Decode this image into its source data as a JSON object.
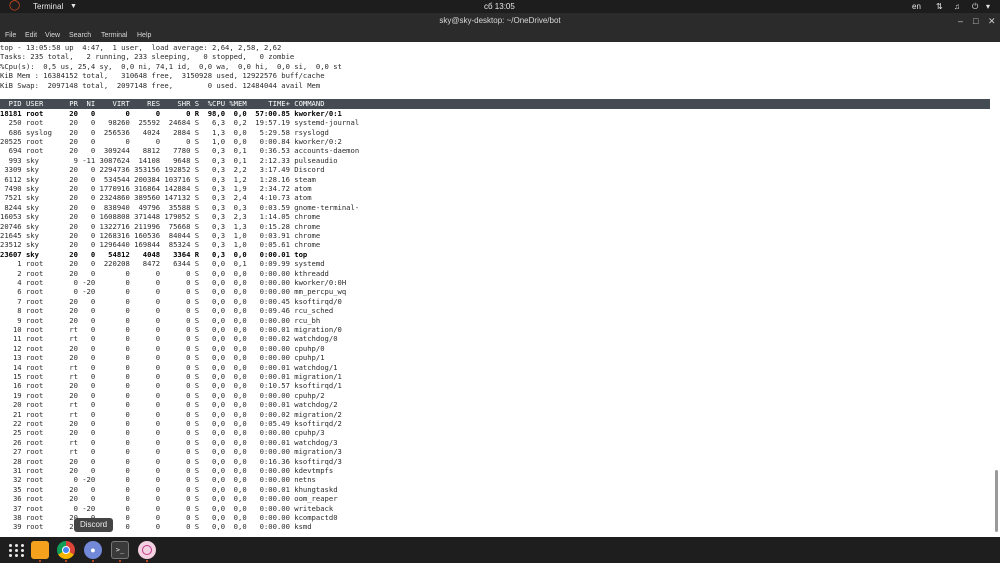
{
  "topbar": {
    "app_name": "Terminal",
    "clock": "сб 13:05",
    "language": "en"
  },
  "window": {
    "title": "sky@sky-desktop: ~/OneDrive/bot"
  },
  "menu": [
    "File",
    "Edit",
    "View",
    "Search",
    "Terminal",
    "Help"
  ],
  "top": {
    "summary": [
      "top - 13:05:58 up  4:47,  1 user,  load average: 2,64, 2,58, 2,62",
      "Tasks: 235 total,   2 running, 233 sleeping,   0 stopped,   0 zombie",
      "%Cpu(s):  0,5 us, 25,4 sy,  0,0 ni, 74,1 id,  0,0 wa,  0,0 hi,  0,0 si,  0,0 st",
      "KiB Mem : 16384152 total,   310648 free,  3150928 used, 12922576 buff/cache",
      "KiB Swap:  2097148 total,  2097148 free,        0 used. 12484044 avail Mem"
    ],
    "header": "  PID USER      PR  NI    VIRT    RES    SHR S  %CPU %MEM     TIME+ COMMAND",
    "processes": [
      {
        "text": "18181 root      20   0       0      0      0 R  98,0  0,0  57:00.85 kworker/0:1",
        "bold": true
      },
      {
        "text": "  250 root      20   0   98260  25592  24684 S   6,3  0,2  19:57.19 systemd-journal",
        "bold": false
      },
      {
        "text": "  686 syslog    20   0  256536   4024   2884 S   1,3  0,0   5:29.58 rsyslogd",
        "bold": false
      },
      {
        "text": "20525 root      20   0       0      0      0 S   1,0  0,0   0:00.84 kworker/0:2",
        "bold": false
      },
      {
        "text": "  694 root      20   0  309244   8812   7780 S   0,3  0,1   0:36.53 accounts-daemon",
        "bold": false
      },
      {
        "text": "  993 sky        9 -11 3087624  14108   9648 S   0,3  0,1   2:12.33 pulseaudio",
        "bold": false
      },
      {
        "text": " 3309 sky       20   0 2294736 353156 192852 S   0,3  2,2   3:17.49 Discord",
        "bold": false
      },
      {
        "text": " 6112 sky       20   0  534544 200384 103716 S   0,3  1,2   1:28.16 steam",
        "bold": false
      },
      {
        "text": " 7490 sky       20   0 1770916 316864 142884 S   0,3  1,9   2:34.72 atom",
        "bold": false
      },
      {
        "text": " 7521 sky       20   0 2324860 389560 147132 S   0,3  2,4   4:10.73 atom",
        "bold": false
      },
      {
        "text": " 8244 sky       20   0  838940  49796  35588 S   0,3  0,3   0:03.59 gnome-terminal-",
        "bold": false
      },
      {
        "text": "16053 sky       20   0 1608808 371448 179052 S   0,3  2,3   1:14.05 chrome",
        "bold": false
      },
      {
        "text": "20746 sky       20   0 1322716 211996  75668 S   0,3  1,3   0:15.28 chrome",
        "bold": false
      },
      {
        "text": "21645 sky       20   0 1268316 160536  84044 S   0,3  1,0   0:03.91 chrome",
        "bold": false
      },
      {
        "text": "23512 sky       20   0 1296440 169844  85324 S   0,3  1,0   0:05.61 chrome",
        "bold": false
      },
      {
        "text": "23607 sky       20   0   54812   4048   3364 R   0,3  0,0   0:00.01 top",
        "bold": true
      },
      {
        "text": "    1 root      20   0  220208   8472   6344 S   0,0  0,1   0:09.99 systemd",
        "bold": false
      },
      {
        "text": "    2 root      20   0       0      0      0 S   0,0  0,0   0:00.00 kthreadd",
        "bold": false
      },
      {
        "text": "    4 root       0 -20       0      0      0 S   0,0  0,0   0:00.00 kworker/0:0H",
        "bold": false
      },
      {
        "text": "    6 root       0 -20       0      0      0 S   0,0  0,0   0:00.00 mm_percpu_wq",
        "bold": false
      },
      {
        "text": "    7 root      20   0       0      0      0 S   0,0  0,0   0:00.45 ksoftirqd/0",
        "bold": false
      },
      {
        "text": "    8 root      20   0       0      0      0 S   0,0  0,0   0:09.46 rcu_sched",
        "bold": false
      },
      {
        "text": "    9 root      20   0       0      0      0 S   0,0  0,0   0:00.00 rcu_bh",
        "bold": false
      },
      {
        "text": "   10 root      rt   0       0      0      0 S   0,0  0,0   0:00.01 migration/0",
        "bold": false
      },
      {
        "text": "   11 root      rt   0       0      0      0 S   0,0  0,0   0:00.02 watchdog/0",
        "bold": false
      },
      {
        "text": "   12 root      20   0       0      0      0 S   0,0  0,0   0:00.00 cpuhp/0",
        "bold": false
      },
      {
        "text": "   13 root      20   0       0      0      0 S   0,0  0,0   0:00.00 cpuhp/1",
        "bold": false
      },
      {
        "text": "   14 root      rt   0       0      0      0 S   0,0  0,0   0:00.01 watchdog/1",
        "bold": false
      },
      {
        "text": "   15 root      rt   0       0      0      0 S   0,0  0,0   0:00.01 migration/1",
        "bold": false
      },
      {
        "text": "   16 root      20   0       0      0      0 S   0,0  0,0   0:10.57 ksoftirqd/1",
        "bold": false
      },
      {
        "text": "   19 root      20   0       0      0      0 S   0,0  0,0   0:00.00 cpuhp/2",
        "bold": false
      },
      {
        "text": "   20 root      rt   0       0      0      0 S   0,0  0,0   0:00.01 watchdog/2",
        "bold": false
      },
      {
        "text": "   21 root      rt   0       0      0      0 S   0,0  0,0   0:00.02 migration/2",
        "bold": false
      },
      {
        "text": "   22 root      20   0       0      0      0 S   0,0  0,0   0:05.49 ksoftirqd/2",
        "bold": false
      },
      {
        "text": "   25 root      20   0       0      0      0 S   0,0  0,0   0:00.00 cpuhp/3",
        "bold": false
      },
      {
        "text": "   26 root      rt   0       0      0      0 S   0,0  0,0   0:00.01 watchdog/3",
        "bold": false
      },
      {
        "text": "   27 root      rt   0       0      0      0 S   0,0  0,0   0:00.00 migration/3",
        "bold": false
      },
      {
        "text": "   28 root      20   0       0      0      0 S   0,0  0,0   0:16.36 ksoftirqd/3",
        "bold": false
      },
      {
        "text": "   31 root      20   0       0      0      0 S   0,0  0,0   0:00.00 kdevtmpfs",
        "bold": false
      },
      {
        "text": "   32 root       0 -20       0      0      0 S   0,0  0,0   0:00.00 netns",
        "bold": false
      },
      {
        "text": "   35 root      20   0       0      0      0 S   0,0  0,0   0:00.01 khungtaskd",
        "bold": false
      },
      {
        "text": "   36 root      20   0       0      0      0 S   0,0  0,0   0:00.00 oom_reaper",
        "bold": false
      },
      {
        "text": "   37 root       0 -20       0      0      0 S   0,0  0,0   0:00.00 writeback",
        "bold": false
      },
      {
        "text": "   38 root      20   0       0      0      0 S   0,0  0,0   0:00.00 kcompactd0",
        "bold": false
      },
      {
        "text": "   39 root      20   0       0      0      0 S   0,0  0,0   0:00.00 ksmd",
        "bold": false
      }
    ]
  },
  "dock": {
    "tooltip": "Discord",
    "apps": [
      "show-applications",
      "files",
      "chrome",
      "discord",
      "terminal",
      "other-app"
    ]
  },
  "icons": {
    "ubuntu_logo": "ubuntu-logo-icon",
    "network": "network-icon",
    "volume": "volume-icon",
    "power": "power-icon"
  },
  "colors": {
    "accent": "#e95420",
    "header_row_bg": "#444b52",
    "terminal_bg": "#ffffff"
  }
}
